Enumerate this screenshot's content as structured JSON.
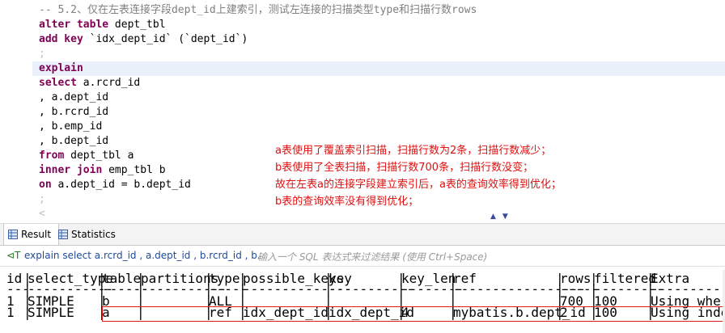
{
  "editor": {
    "lines": [
      {
        "text": "-- 5.2、仅在左表连接字段dept_id上建索引，测试左连接的扫描类型type和扫描行数rows",
        "style": "comment"
      },
      {
        "text": "alter table dept_tbl",
        "style": "mixed",
        "kw": "alter table",
        "rest": " dept_tbl"
      },
      {
        "text": "add key `idx_dept_id` (`dept_id`)",
        "style": "mixed",
        "kw": "add key",
        "rest": " `idx_dept_id` (`dept_id`)"
      },
      {
        "text": ";",
        "style": "semi"
      },
      {
        "text": "explain",
        "style": "kw"
      },
      {
        "text": "select a.rcrd_id",
        "style": "mixed",
        "kw": "select",
        "rest": " a.rcrd_id"
      },
      {
        "text": ", a.dept_id",
        "style": "plain"
      },
      {
        "text": ", b.rcrd_id",
        "style": "plain"
      },
      {
        "text": ", b.emp_id",
        "style": "plain"
      },
      {
        "text": ", b.dept_id",
        "style": "plain"
      },
      {
        "text": "from dept_tbl a",
        "style": "mixed",
        "kw": "from",
        "rest": " dept_tbl a"
      },
      {
        "text": "inner join emp_tbl b",
        "style": "mixed",
        "kw": "inner join",
        "rest": " emp_tbl b"
      },
      {
        "text": "on a.dept_id = b.dept_id",
        "style": "mixed",
        "kw": "on",
        "rest": " a.dept_id = b.dept_id"
      },
      {
        "text": ";",
        "style": "semi"
      },
      {
        "text": "<",
        "style": "semi"
      }
    ],
    "notes": [
      "a表使用了覆盖索引扫描，扫描行数为2条，扫描行数减少；",
      "b表使用了全表扫描，扫描行数700条，扫描行数没变；",
      "故在左表a的连接字段建立索引后，a表的查询效率得到优化；",
      "b表的查询效率没有得到优化；"
    ]
  },
  "tabs": {
    "result_label": "Result",
    "statistics_label": "Statistics"
  },
  "filter": {
    "sql_text": "explain select a.rcrd_id , a.dept_id , b.rcrd_id , b.",
    "placeholder": "输入一个 SQL 表达式来过滤结果 (使用 Ctrl+Space)"
  },
  "results": {
    "columns": [
      "id",
      "select_type",
      "table",
      "partitions",
      "type",
      "possible_keys",
      "key",
      "key_len",
      "ref",
      "rows",
      "filtered",
      "Extra"
    ],
    "rows": [
      [
        "1",
        "SIMPLE",
        "b",
        "",
        "ALL",
        "",
        "",
        "",
        "",
        "700",
        "100",
        "Using where"
      ],
      [
        "1",
        "SIMPLE",
        "a",
        "",
        "ref",
        "idx_dept_id",
        "idx_dept_id",
        "4",
        "mybatis.b.dept_id",
        "2",
        "100",
        "Using index"
      ]
    ]
  },
  "colors": {
    "keyword": "#7f0055",
    "comment": "#808080",
    "note": "#e01010",
    "highlight_box": "#e01a1a"
  }
}
